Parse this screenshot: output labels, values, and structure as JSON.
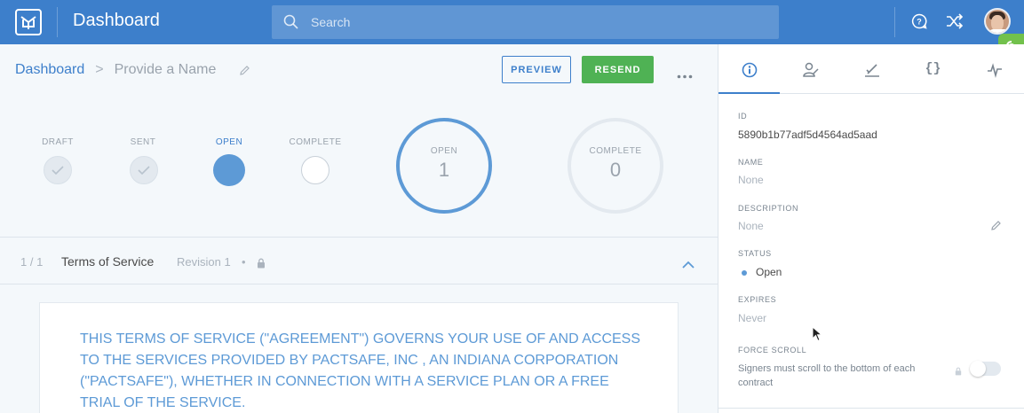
{
  "topbar": {
    "title": "Dashboard",
    "search_placeholder": "Search",
    "icons": [
      "pactsafe-logo-icon",
      "search-icon",
      "help-icon",
      "shuffle-icon",
      "avatar"
    ]
  },
  "breadcrumb": {
    "root": "Dashboard",
    "separator": ">",
    "current": "Provide a Name"
  },
  "actions": {
    "preview_label": "PREVIEW",
    "resend_label": "RESEND"
  },
  "steps": [
    {
      "label": "DRAFT",
      "state": "done"
    },
    {
      "label": "SENT",
      "state": "done"
    },
    {
      "label": "OPEN",
      "state": "active"
    },
    {
      "label": "COMPLETE",
      "state": "empty"
    }
  ],
  "counters": {
    "open": {
      "label": "OPEN",
      "value": "1"
    },
    "complete": {
      "label": "COMPLETE",
      "value": "0"
    }
  },
  "section": {
    "count": "1 / 1",
    "title": "Terms of Service",
    "revision": "Revision 1",
    "dot": "•"
  },
  "document": {
    "text": "THIS TERMS OF SERVICE (\"AGREEMENT\") GOVERNS YOUR USE OF AND ACCESS TO THE SERVICES PROVIDED BY PACTSAFE, INC , AN INDIANA CORPORATION (\"PACTSAFE\"), WHETHER IN CONNECTION WITH A SERVICE PLAN OR A FREE TRIAL OF THE SERVICE."
  },
  "side_panel": {
    "tabs": [
      {
        "name": "info",
        "icon": "info-icon",
        "active": true
      },
      {
        "name": "signer",
        "icon": "signer-icon"
      },
      {
        "name": "signature",
        "icon": "signature-icon"
      },
      {
        "name": "data",
        "text": "{}"
      },
      {
        "name": "activity",
        "icon": "activity-icon"
      }
    ],
    "fields": {
      "id_label": "ID",
      "id_value": "5890b1b77adf5d4564ad5aad",
      "name_label": "NAME",
      "name_value": "None",
      "description_label": "DESCRIPTION",
      "description_value": "None",
      "status_label": "STATUS",
      "status_value": "Open",
      "expires_label": "EXPIRES",
      "expires_value": "Never",
      "force_scroll_label": "FORCE SCROLL",
      "force_scroll_desc": "Signers must scroll to the bottom of each contract",
      "force_scroll_enabled": false
    }
  },
  "colors": {
    "brand_blue": "#3d7fcb",
    "green": "#4fb254",
    "open_blue": "#5d9ad6"
  }
}
